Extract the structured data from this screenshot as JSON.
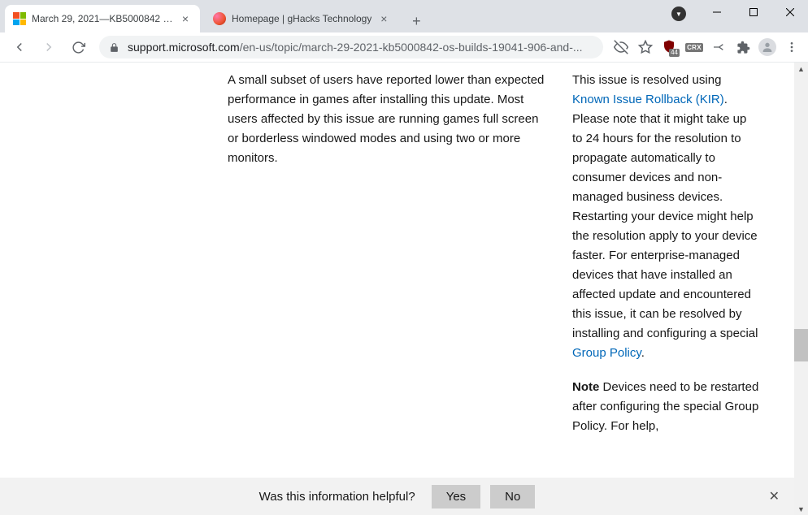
{
  "window": {
    "badge_indicator": "▼"
  },
  "tabs": [
    {
      "title": "March 29, 2021—KB5000842 (OS",
      "active": true
    },
    {
      "title": "Homepage | gHacks Technology",
      "active": false
    }
  ],
  "url": {
    "domain": "support.microsoft.com",
    "path": "/en-us/topic/march-29-2021-kb5000842-os-builds-19041-906-and-..."
  },
  "extensions": {
    "ublock_count": "44",
    "crx_label": "CRX"
  },
  "article": {
    "left_paragraph": "A small subset of users have reported lower than expected performance in games after installing this update. Most users affected by this issue are running games full screen or borderless windowed modes and using two or more monitors.",
    "right_p1_a": "This issue is resolved using ",
    "right_link1": "Known Issue Rollback (KIR)",
    "right_p1_b": ". Please note that it might take up to 24 hours for the resolution to propagate automatically to consumer devices and non-managed business devices. Restarting your device might help the resolution apply to your device faster. For enterprise-managed devices that have installed an affected update and encountered this issue, it can be resolved by installing and configuring a special ",
    "right_link2": "Group Policy",
    "right_p1_c": ".",
    "note_label": "Note",
    "right_p2": " Devices need to be restarted after configuring the special Group Policy. For help,"
  },
  "feedback": {
    "question": "Was this information helpful?",
    "yes": "Yes",
    "no": "No"
  }
}
